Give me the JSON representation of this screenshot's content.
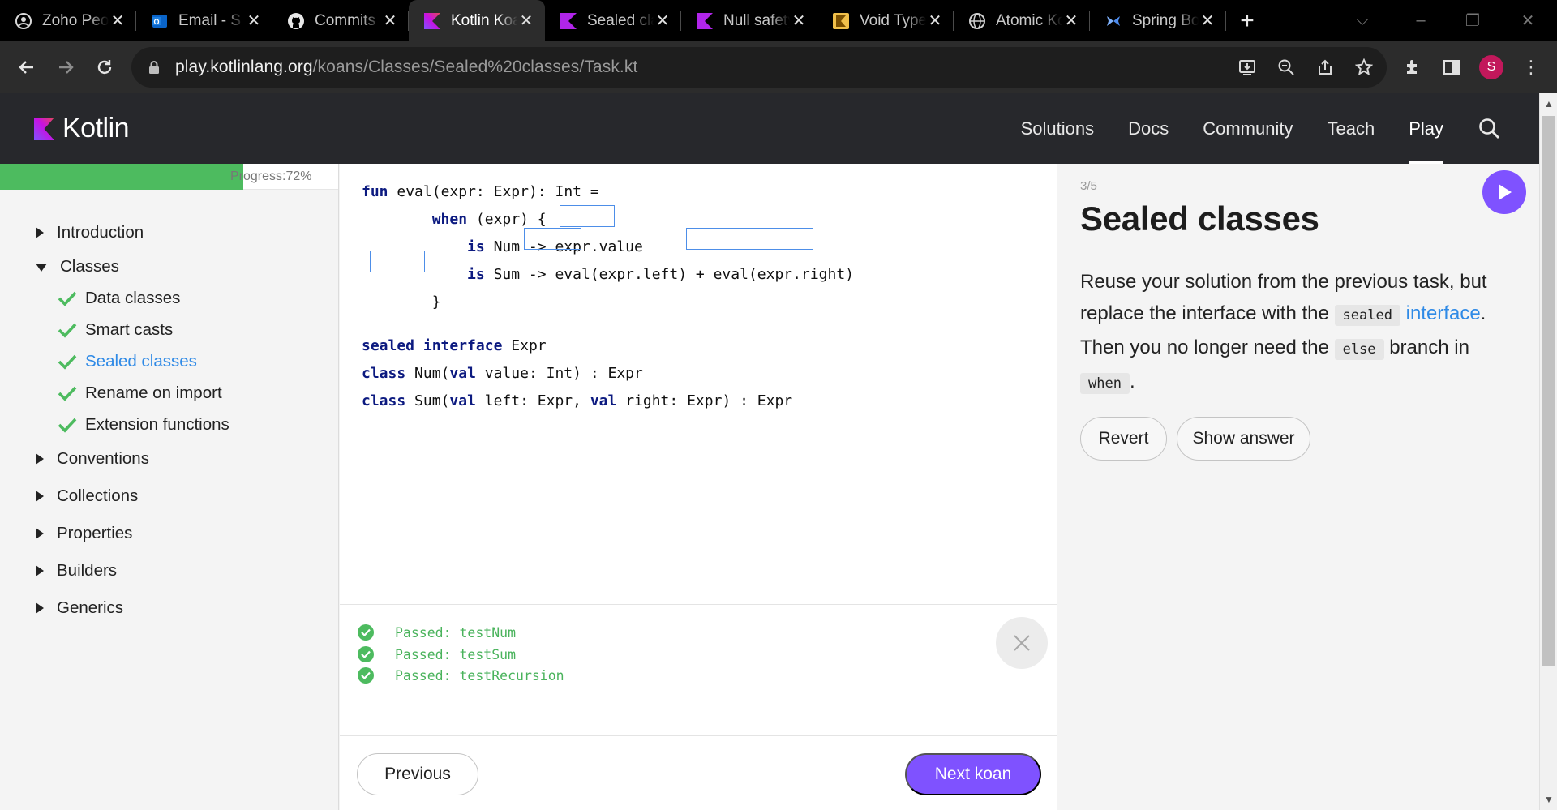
{
  "browser": {
    "tabs": [
      {
        "title": "Zoho People",
        "icon": "zoho-people-icon"
      },
      {
        "title": "Email - S",
        "icon": "outlook-icon"
      },
      {
        "title": "Commits",
        "icon": "github-icon"
      },
      {
        "title": "Kotlin Koans",
        "icon": "kotlin-icon",
        "active": true
      },
      {
        "title": "Sealed classes",
        "icon": "kotlin-icon"
      },
      {
        "title": "Null safety",
        "icon": "kotlin-icon"
      },
      {
        "title": "Void Type",
        "icon": "kotlin-yellow-icon"
      },
      {
        "title": "Atomic Kotlin",
        "icon": "globe-icon"
      },
      {
        "title": "Spring Boot",
        "icon": "spring-icon"
      }
    ],
    "url_host": "play.kotlinlang.org",
    "url_path": "/koans/Classes/Sealed%20classes/Task.kt",
    "profile_initial": "S"
  },
  "site": {
    "logo_text": "Kotlin",
    "nav": [
      {
        "label": "Solutions"
      },
      {
        "label": "Docs"
      },
      {
        "label": "Community"
      },
      {
        "label": "Teach"
      },
      {
        "label": "Play",
        "active": true
      }
    ]
  },
  "sidebar": {
    "progress_label": "Progress:72%",
    "progress_value": 0.72,
    "sections": [
      {
        "label": "Introduction",
        "open": false
      },
      {
        "label": "Classes",
        "open": true,
        "items": [
          {
            "label": "Data classes",
            "done": true
          },
          {
            "label": "Smart casts",
            "done": true
          },
          {
            "label": "Sealed classes",
            "done": true,
            "current": true
          },
          {
            "label": "Rename on import",
            "done": true
          },
          {
            "label": "Extension functions",
            "done": true
          }
        ]
      },
      {
        "label": "Conventions",
        "open": false
      },
      {
        "label": "Collections",
        "open": false
      },
      {
        "label": "Properties",
        "open": false
      },
      {
        "label": "Builders",
        "open": false
      },
      {
        "label": "Generics",
        "open": false
      }
    ]
  },
  "editor": {
    "lines": [
      "fun eval(expr: Expr): Int =",
      "        when (expr) {",
      "            is Num -> expr.value",
      "            is Sum -> eval(expr.left) + eval(expr.right)",
      "        }",
      "",
      "sealed interface Expr",
      "class Num(val value: Int) : Expr",
      "class Sum(val left: Expr, val right: Expr) : Expr"
    ]
  },
  "results": [
    "Passed: testNum",
    "Passed: testSum",
    "Passed: testRecursion"
  ],
  "footer": {
    "previous_label": "Previous",
    "next_label": "Next koan"
  },
  "task": {
    "counter": "3/5",
    "title": "Sealed classes",
    "desc_1": "Reuse your solution from the previous task, but replace the interface with the ",
    "code_sealed": "sealed",
    "link_interface": "interface",
    "desc_2": ". Then you no longer need the ",
    "code_else": "else",
    "desc_3": " branch in ",
    "code_when": "when",
    "desc_4": ".",
    "revert_label": "Revert",
    "show_answer_label": "Show answer"
  },
  "colors": {
    "accent": "#7f52ff",
    "progress": "#4dbb5f",
    "link": "#2f8ae6",
    "keyword": "#0c1a80",
    "passed": "#4ab35c"
  }
}
